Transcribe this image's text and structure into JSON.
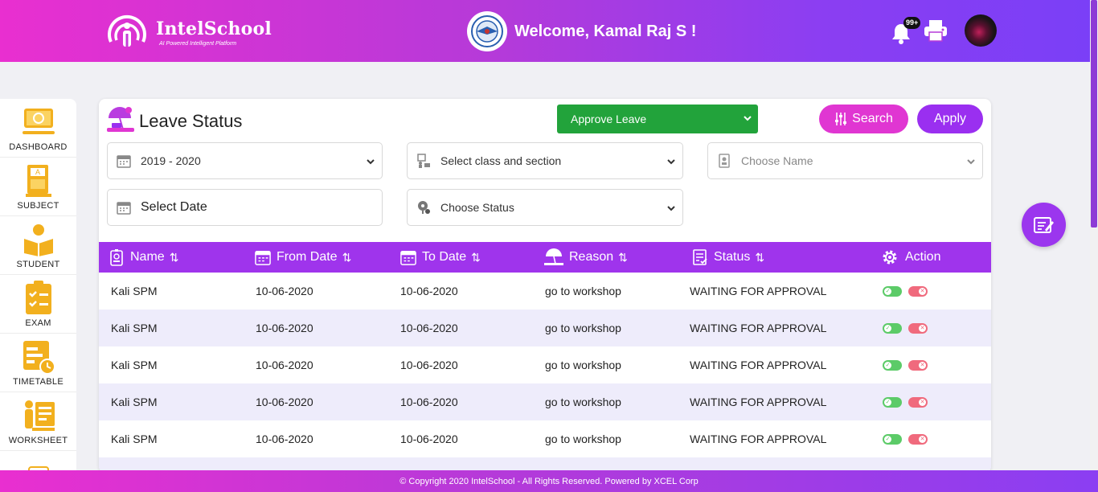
{
  "header": {
    "brand": "IntelSchool",
    "tagline": "AI Powered Intelligent Platform",
    "welcome": "Welcome, Kamal Raj S !",
    "notification_count": "99+"
  },
  "sidebar": {
    "items": [
      {
        "label": "DASHBOARD",
        "icon": "dashboard-icon"
      },
      {
        "label": "SUBJECT",
        "icon": "subject-icon"
      },
      {
        "label": "STUDENT",
        "icon": "student-icon"
      },
      {
        "label": "EXAM",
        "icon": "exam-icon"
      },
      {
        "label": "TIMETABLE",
        "icon": "timetable-icon"
      },
      {
        "label": "WORKSHEET",
        "icon": "worksheet-icon"
      }
    ]
  },
  "page": {
    "title": "Leave Status",
    "approve_select": "Approve Leave",
    "search_label": "Search",
    "apply_label": "Apply"
  },
  "filters": {
    "year": "2019 - 2020",
    "class_section": "Select class and section",
    "name": "Choose Name",
    "date": "Select Date",
    "status": "Choose Status"
  },
  "table": {
    "columns": [
      "Name",
      "From Date",
      "To Date",
      "Reason",
      "Status",
      "Action"
    ],
    "rows": [
      {
        "name": "Kali SPM",
        "from": "10-06-2020",
        "to": "10-06-2020",
        "reason": "go to workshop",
        "status": "WAITING FOR APPROVAL"
      },
      {
        "name": "Kali SPM",
        "from": "10-06-2020",
        "to": "10-06-2020",
        "reason": "go to workshop",
        "status": "WAITING FOR APPROVAL"
      },
      {
        "name": "Kali SPM",
        "from": "10-06-2020",
        "to": "10-06-2020",
        "reason": "go to workshop",
        "status": "WAITING FOR APPROVAL"
      },
      {
        "name": "Kali SPM",
        "from": "10-06-2020",
        "to": "10-06-2020",
        "reason": "go to workshop",
        "status": "WAITING FOR APPROVAL"
      },
      {
        "name": "Kali SPM",
        "from": "10-06-2020",
        "to": "10-06-2020",
        "reason": "go to workshop",
        "status": "WAITING FOR APPROVAL"
      }
    ]
  },
  "footer": {
    "copyright": "© Copyright 2020 IntelSchool - All Rights Reserved. Powered by XCEL Corp"
  },
  "colors": {
    "header_start": "#e92fd0",
    "header_end": "#7a3ff7",
    "table_header": "#9f34ec",
    "approve_green": "#22a33b",
    "search_pink": "#e036d2",
    "apply_purple": "#9a2ff0",
    "sidebar_icon": "#f2b01e"
  }
}
